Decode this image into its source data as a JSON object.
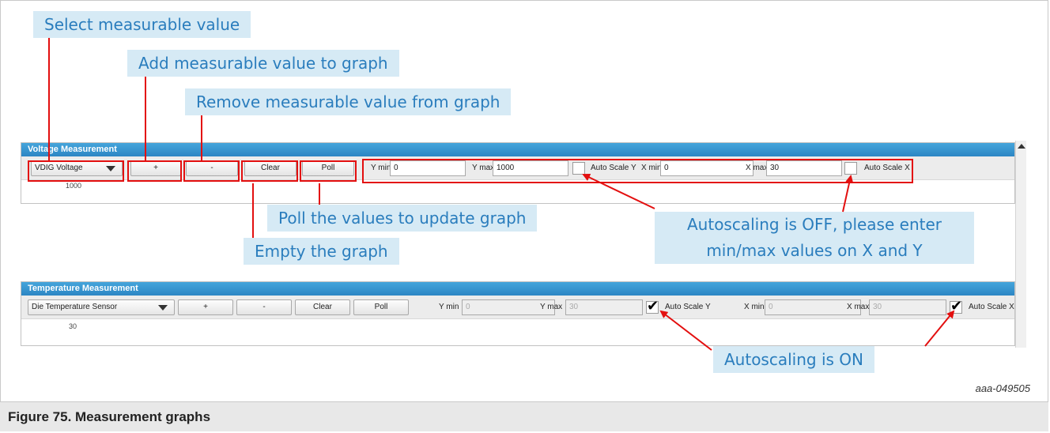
{
  "callouts": {
    "select_value": "Select measurable value",
    "add_value": "Add measurable value to graph",
    "remove_value": "Remove measurable value from graph",
    "poll_values": "Poll the values to update graph",
    "empty_graph": "Empty the graph",
    "autoscale_off": "Autoscaling is OFF, please enter min/max values on X and Y",
    "autoscale_on": "Autoscaling is ON"
  },
  "voltage_panel": {
    "title": "Voltage Measurement",
    "select_value": "VDIG Voltage",
    "add_label": "+",
    "remove_label": "-",
    "clear_label": "Clear",
    "poll_label": "Poll",
    "ymin_label": "Y min",
    "ymin_value": "0",
    "ymax_label": "Y max",
    "ymax_value": "1000",
    "autoscale_y_label": "Auto Scale Y",
    "autoscale_y_checked": false,
    "xmin_label": "X min",
    "xmin_value": "0",
    "xmax_label": "X max",
    "xmax_value": "30",
    "autoscale_x_label": "Auto Scale X",
    "autoscale_x_checked": false,
    "y_tick_top": "1000"
  },
  "temperature_panel": {
    "title": "Temperature Measurement",
    "select_value": "Die Temperature Sensor",
    "add_label": "+",
    "remove_label": "-",
    "clear_label": "Clear",
    "poll_label": "Poll",
    "ymin_label": "Y min",
    "ymin_value": "0",
    "ymax_label": "Y max",
    "ymax_value": "30",
    "autoscale_y_label": "Auto Scale Y",
    "autoscale_y_checked": true,
    "xmin_label": "X min",
    "xmin_value": "0",
    "xmax_label": "X max",
    "xmax_value": "30",
    "autoscale_x_label": "Auto Scale X",
    "autoscale_x_checked": true,
    "y_tick_top": "30"
  },
  "figure": {
    "id": "aaa-049505",
    "caption": "Figure 75.  Measurement graphs"
  },
  "colors": {
    "callout_bg": "#d6eaf5",
    "callout_text": "#2a7dbd",
    "highlight": "#e30f0f",
    "panel_header": "#2c86c4"
  }
}
